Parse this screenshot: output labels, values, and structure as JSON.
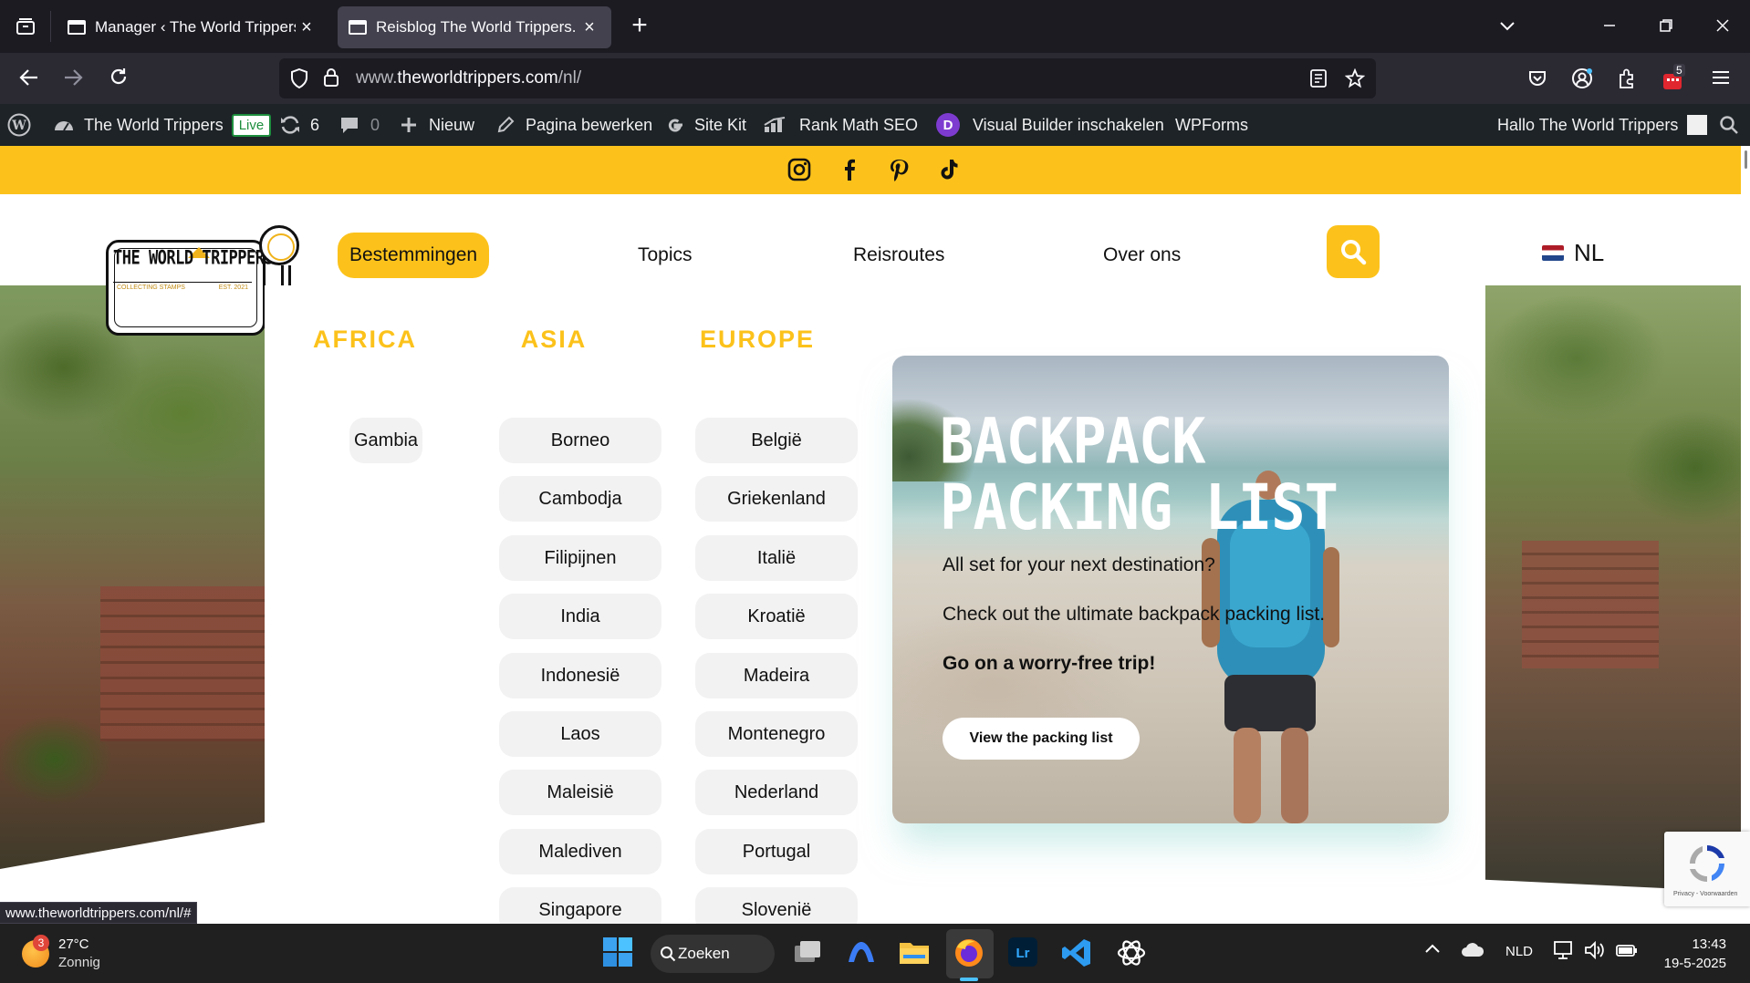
{
  "browser": {
    "tabs": [
      {
        "title": "Manager ‹ The World Trippers — ",
        "close": "×"
      },
      {
        "title": "Reisblog The World Trippers. Vo",
        "close": "×"
      }
    ],
    "new_tab": "+",
    "url_prefix": "www.",
    "url_host": "theworldtrippers.com",
    "url_path": "/nl/",
    "extensions_badge": "5"
  },
  "adminbar": {
    "site_name": "The World Trippers",
    "live_label": "Live",
    "updates_count": "6",
    "comments_count": "0",
    "new_label": "Nieuw",
    "edit_label": "Pagina bewerken",
    "sitekit_label": "Site Kit",
    "rankmath_label": "Rank Math SEO",
    "divi_letter": "D",
    "visual_builder_label": "Visual Builder inschakelen",
    "wpforms_label": "WPForms",
    "greeting": "Hallo The World Trippers"
  },
  "site": {
    "logo_title": "THE WORLD TRIPPERS",
    "logo_sub_left": "COLLECTING STAMPS",
    "logo_sub_right": "EST. 2021",
    "menu": [
      "Bestemmingen",
      "Topics",
      "Reisroutes",
      "Over ons"
    ],
    "lang": "NL",
    "accent": "#fcc21b"
  },
  "mega_menu": {
    "columns": [
      {
        "heading": "AFRICA",
        "items": [
          "Gambia"
        ]
      },
      {
        "heading": "ASIA",
        "items": [
          "Borneo",
          "Cambodja",
          "Filipijnen",
          "India",
          "Indonesië",
          "Laos",
          "Maleisië",
          "Malediven",
          "Singapore"
        ]
      },
      {
        "heading": "EUROPE",
        "items": [
          "België",
          "Griekenland",
          "Italië",
          "Kroatië",
          "Madeira",
          "Montenegro",
          "Nederland",
          "Portugal",
          "Slovenië"
        ]
      }
    ],
    "card": {
      "title_line1": "BACKPACK",
      "title_line2": "PACKING LIST",
      "line1": "All set for your next destination?",
      "line2": "Check out the ultimate backpack packing list.",
      "line3": "Go on a worry-free trip!",
      "button": "View the packing list"
    }
  },
  "recaptcha_text": "Privacy - Voorwaarden",
  "status_url": "www.theworldtrippers.com/nl/#",
  "taskbar": {
    "weather_badge": "3",
    "temperature": "27°C",
    "condition": "Zonnig",
    "search_label": "Zoeken",
    "language": "NLD",
    "time": "13:43",
    "date": "19-5-2025"
  }
}
